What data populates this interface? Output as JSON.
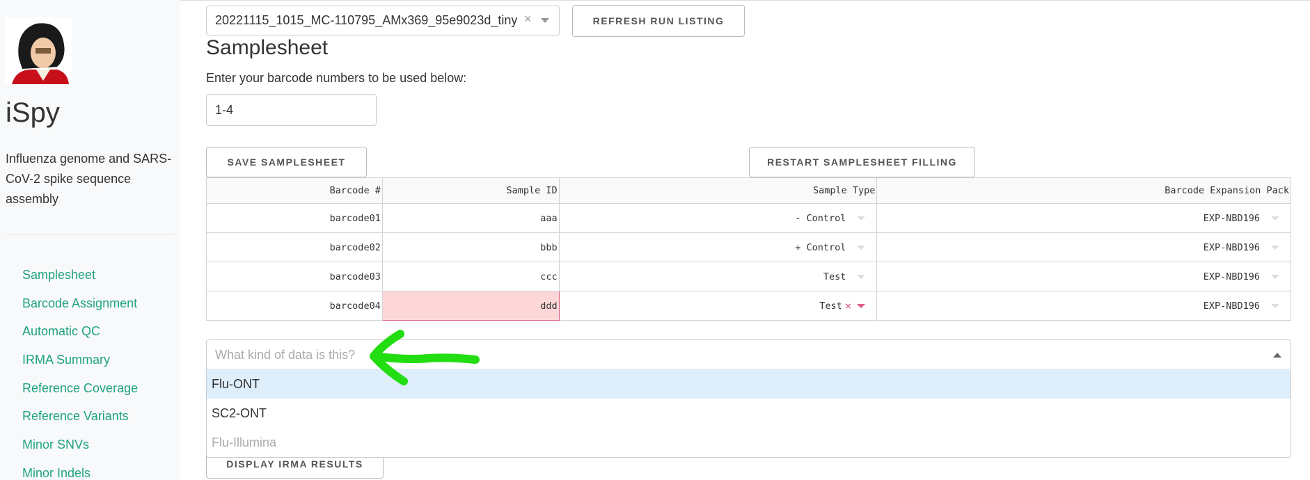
{
  "sidebar": {
    "app_title": "iSpy",
    "app_description": "Influenza genome and SARS-CoV-2 spike sequence assembly",
    "nav": [
      "Samplesheet",
      "Barcode Assignment",
      "Automatic QC",
      "IRMA Summary",
      "Reference Coverage",
      "Reference Variants",
      "Minor SNVs",
      "Minor Indels"
    ]
  },
  "run_select": {
    "value": "20221115_1015_MC-110795_AMx369_95e9023d_tiny",
    "clear_glyph": "×"
  },
  "buttons": {
    "refresh": "REFRESH RUN LISTING",
    "save": "SAVE SAMPLESHEET",
    "restart": "RESTART SAMPLESHEET FILLING",
    "display_irma": "DISPLAY IRMA RESULTS"
  },
  "samplesheet": {
    "title": "Samplesheet",
    "barcode_prompt": "Enter your barcode numbers to be used below:",
    "barcode_value": "1-4"
  },
  "table": {
    "headers": [
      "Barcode #",
      "Sample ID",
      "Sample Type",
      "Barcode Expansion Pack"
    ],
    "rows": [
      {
        "barcode": "barcode01",
        "sample_id": "aaa",
        "sample_type": "- Control",
        "expansion": "EXP-NBD196"
      },
      {
        "barcode": "barcode02",
        "sample_id": "bbb",
        "sample_type": "+ Control",
        "expansion": "EXP-NBD196"
      },
      {
        "barcode": "barcode03",
        "sample_id": "ccc",
        "sample_type": "Test",
        "expansion": "EXP-NBD196"
      },
      {
        "barcode": "barcode04",
        "sample_id": "ddd",
        "sample_type": "Test",
        "expansion": "EXP-NBD196"
      }
    ],
    "clear_glyph": "×"
  },
  "data_type_dropdown": {
    "placeholder": "What kind of data is this?",
    "options": [
      "Flu-ONT",
      "SC2-ONT",
      "Flu-Illumina"
    ],
    "highlighted_option": "Flu-ONT",
    "disabled_option": "Flu-Illumina"
  },
  "colors": {
    "nav_link": "#1fa37f",
    "annotation_arrow": "#22dd11",
    "invalid_cell_bg": "#fdd7d7",
    "invalid_accent": "#e05c8b",
    "highlight_option_bg": "#dfeefb"
  },
  "icons": {
    "logo": "portrait-logo-image",
    "clear": "close-icon",
    "caret": "chevron-down-icon",
    "annotation": "arrow-left-icon"
  }
}
